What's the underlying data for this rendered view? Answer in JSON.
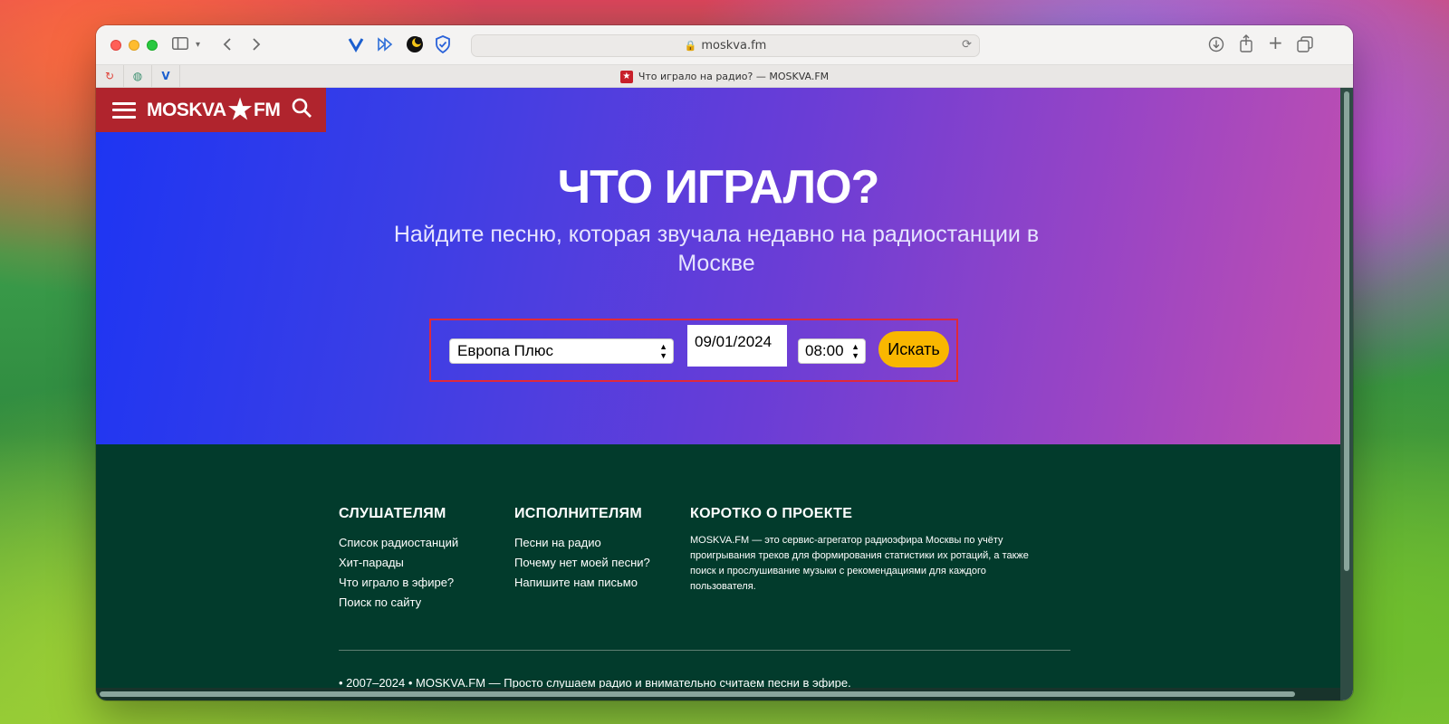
{
  "browser": {
    "url": "moskva.fm",
    "tab_title": "Что играло на радио? — MOSKVA.FM"
  },
  "site": {
    "logo_left": "MOSKVA",
    "logo_right": "FM",
    "hero_title": "ЧТО ИГРАЛО?",
    "hero_subtitle": "Найдите песню, которая звучала недавно на радиостанции в Москве",
    "search": {
      "station": "Европа Плюс",
      "date": "09/01/2024",
      "time": "08:00",
      "button": "Искать"
    }
  },
  "footer": {
    "listeners": {
      "title": "СЛУШАТЕЛЯМ",
      "links": [
        "Список радиостанций",
        "Хит-парады",
        "Что играло в эфире?",
        "Поиск по сайту"
      ]
    },
    "artists": {
      "title": "ИСПОЛНИТЕЛЯМ",
      "links": [
        "Песни на радио",
        "Почему нет моей песни?",
        "Напишите нам письмо"
      ]
    },
    "about": {
      "title": "КОРОТКО О ПРОЕКТЕ",
      "text": "MOSKVA.FM — это сервис-агрегатор радиоэфира Москвы по учёту проигрывания треков для формирования статистики их ротаций, а также поиск и прослушивание музыки с рекомендациями для каждого пользователя."
    },
    "copyright": "• 2007–2024 • MOSKVA.FM — Просто слушаем радио и внимательно считаем песни в эфире."
  },
  "colors": {
    "brand_red": "#b0242d",
    "accent_yellow": "#f9b700",
    "footer_bg": "#023b2c"
  }
}
